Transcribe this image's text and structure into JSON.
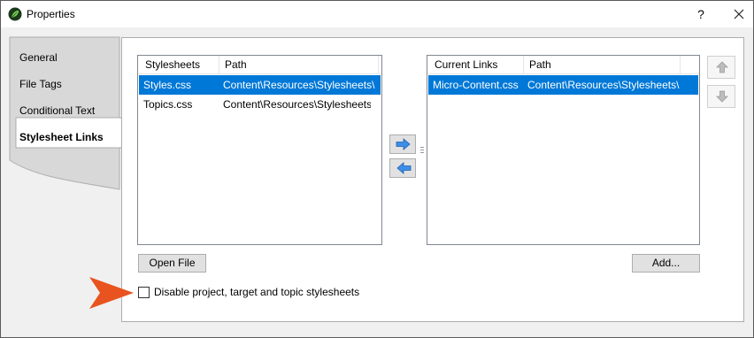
{
  "window": {
    "title": "Properties",
    "help_label": "?",
    "icon": "app-leaf-icon",
    "close_icon": "close-icon"
  },
  "tabs": [
    {
      "label": "General",
      "active": false
    },
    {
      "label": "File Tags",
      "active": false
    },
    {
      "label": "Conditional Text",
      "active": false
    },
    {
      "label": "Stylesheet Links",
      "active": true
    }
  ],
  "stylesheets": {
    "columns": [
      "Stylesheets",
      "Path"
    ],
    "rows": [
      {
        "name": "Styles.css",
        "path": "Content\\Resources\\Stylesheets\\",
        "selected": true
      },
      {
        "name": "Topics.css",
        "path": "Content\\Resources\\Stylesheets\\",
        "selected": false
      }
    ]
  },
  "current_links": {
    "columns": [
      "Current Links",
      "Path"
    ],
    "rows": [
      {
        "name": "Micro-Content.css",
        "path": "Content\\Resources\\Stylesheets\\",
        "selected": true
      }
    ]
  },
  "buttons": {
    "open_file": "Open File",
    "add": "Add...",
    "move_right_icon": "arrow-right-icon",
    "move_left_icon": "arrow-left-icon",
    "move_up_icon": "arrow-up-icon",
    "move_down_icon": "arrow-down-icon"
  },
  "options": {
    "disable_label": "Disable project, target and topic stylesheets",
    "disable_checked": false
  },
  "colors": {
    "selection": "#0078d7",
    "callout_arrow": "#e8531f"
  }
}
